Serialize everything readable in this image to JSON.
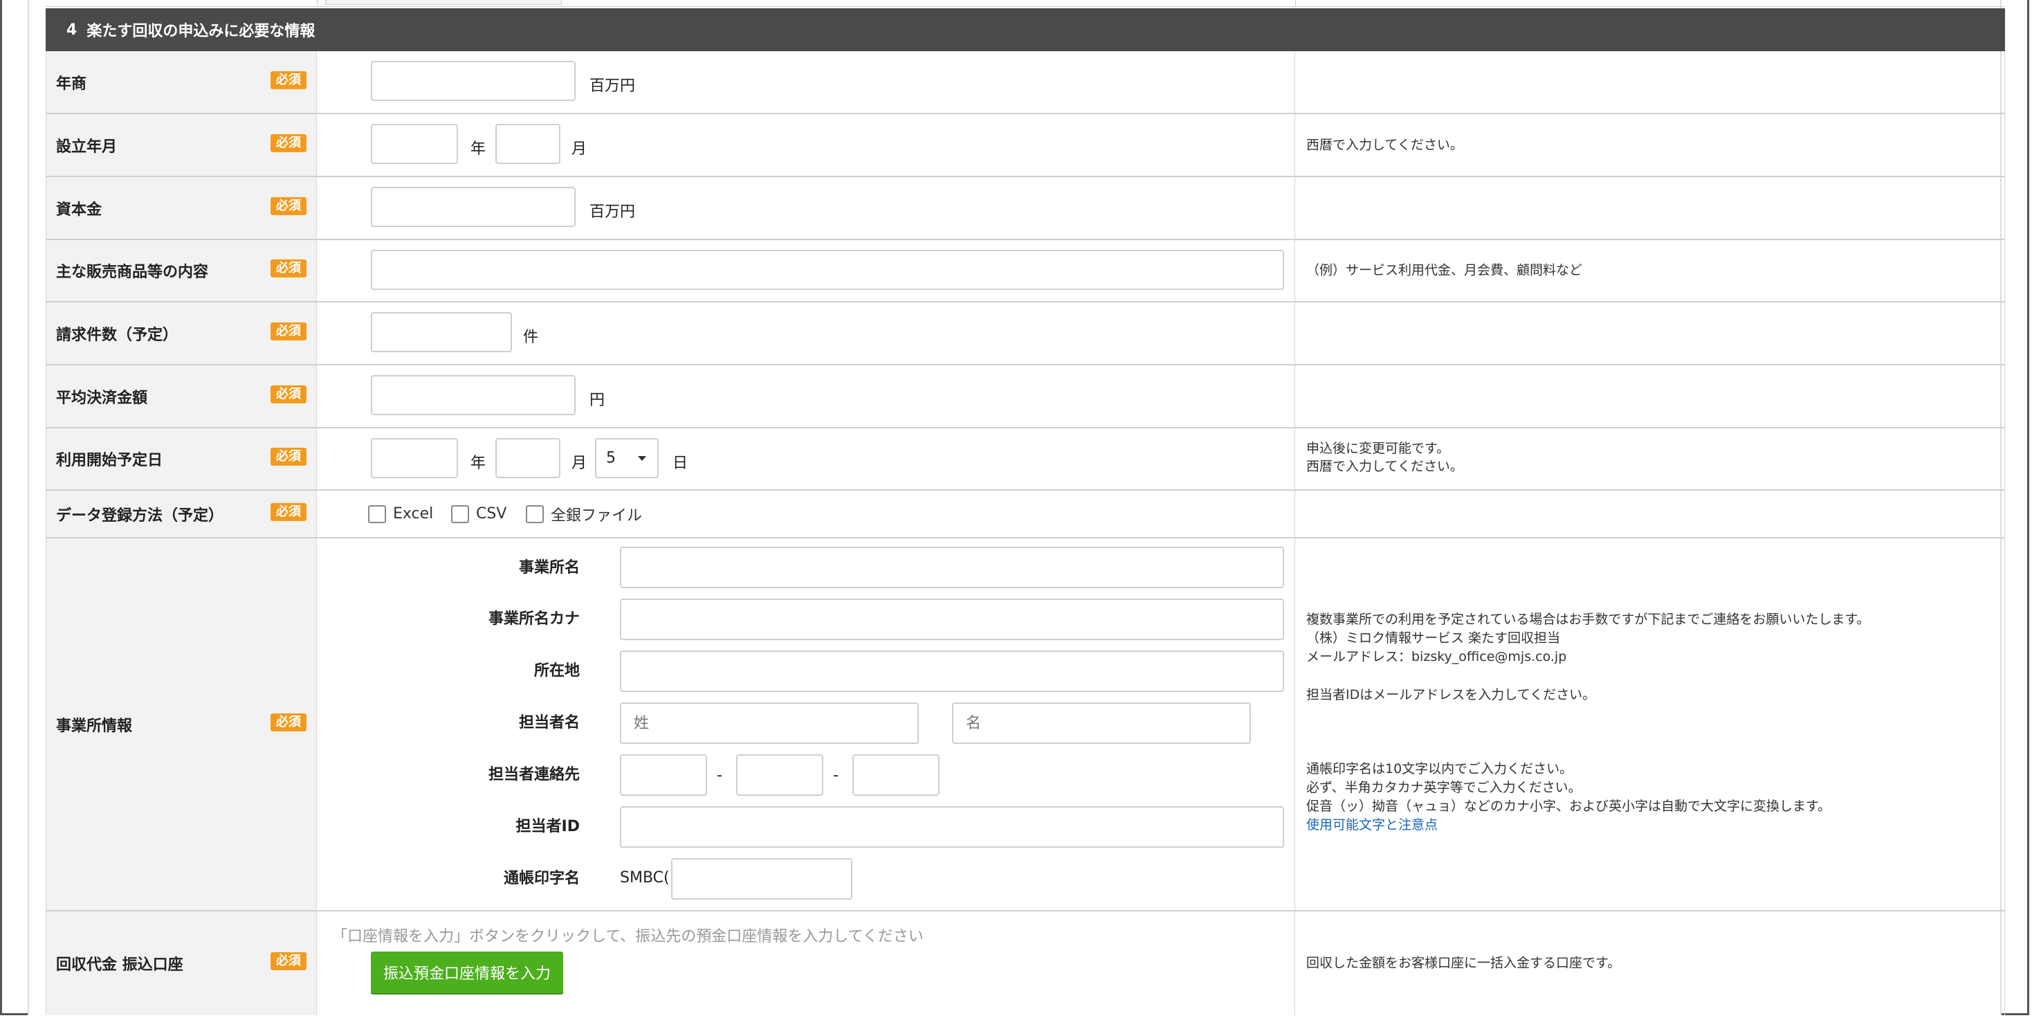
{
  "section": {
    "number": "4",
    "title": "楽たす回収の申込みに必要な情報"
  },
  "required_badge": "必須",
  "rows": {
    "annual_sales": {
      "label": "年商",
      "unit": "百万円"
    },
    "established": {
      "label": "設立年月",
      "unit_year": "年",
      "unit_month": "月",
      "note": "西暦で入力してください。"
    },
    "capital": {
      "label": "資本金",
      "unit": "百万円"
    },
    "main_products": {
      "label": "主な販売商品等の内容",
      "note": "（例）サービス利用代金、月会費、顧問料など"
    },
    "billing_count": {
      "label": "請求件数（予定）",
      "unit": "件"
    },
    "avg_amount": {
      "label": "平均決済金額",
      "unit": "円"
    },
    "start_date": {
      "label": "利用開始予定日",
      "unit_year": "年",
      "unit_month": "月",
      "unit_day": "日",
      "day_value": "5",
      "note_line1": "申込後に変更可能です。",
      "note_line2": "西暦で入力してください。"
    },
    "data_method": {
      "label": "データ登録方法（予定）",
      "options": [
        "Excel",
        "CSV",
        "全銀ファイル"
      ]
    },
    "office": {
      "label": "事業所情報",
      "fields": {
        "name": "事業所名",
        "kana": "事業所名カナ",
        "address": "所在地",
        "person": "担当者名",
        "contact": "担当者連絡先",
        "person_id": "担当者ID",
        "passbook": "通帳印字名"
      },
      "last_name_placeholder": "姓",
      "first_name_placeholder": "名",
      "dash": "-",
      "passbook_prefix": "SMBC(",
      "notes": {
        "l1": "複数事業所での利用を予定されている場合はお手数ですが下記までご連絡をお願いいたします。",
        "l2": "（株）ミロク情報サービス 楽たす回収担当",
        "l3": "メールアドレス：bizsky_office@mjs.co.jp",
        "l4": "担当者IDはメールアドレスを入力してください。",
        "l5": "通帳印字名は10文字以内でご入力ください。",
        "l6": "必ず、半角カタカナ英字等でご入力ください。",
        "l7": "促音（ッ）拗音（ャュョ）などのカナ小字、および英小字は自動で大文字に変換します。",
        "link": "使用可能文字と注意点"
      }
    },
    "bank": {
      "label": "回収代金 振込口座",
      "hint": "「口座情報を入力」ボタンをクリックして、振込先の預金口座情報を入力してください",
      "button": "振込預金口座情報を入力",
      "note": "回収した金額をお客様口座に一括入金する口座です。"
    }
  },
  "colors": {
    "header_bg": "#4a4a4a",
    "badge": "#f39a1e",
    "button": "#4caf1d",
    "link": "#1a66b8"
  }
}
